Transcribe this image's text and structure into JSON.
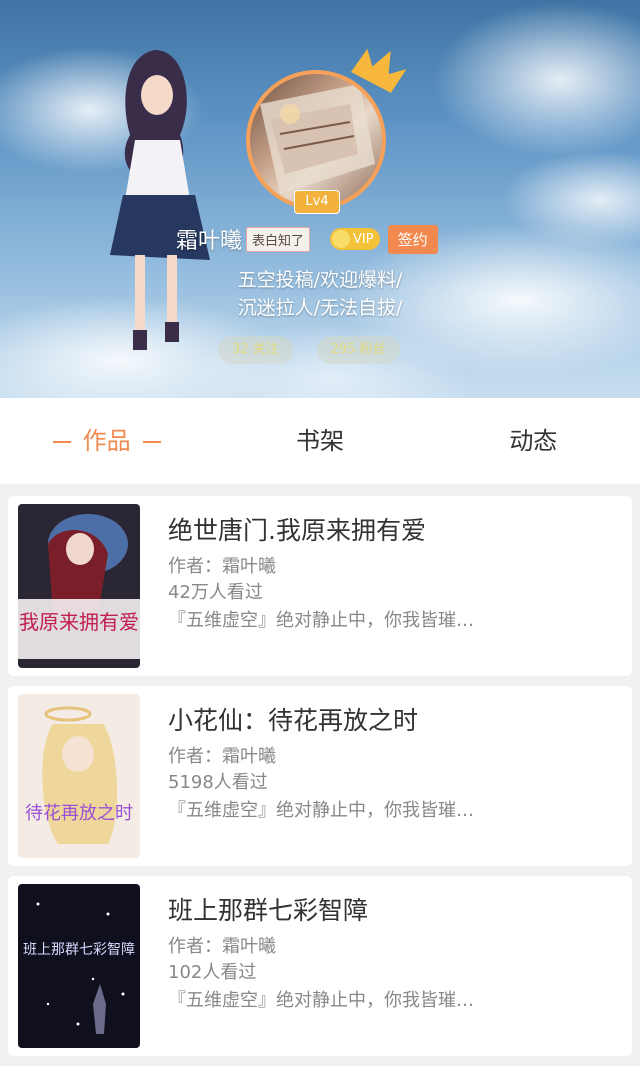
{
  "profile": {
    "level": "Lv4",
    "name": "霜叶曦",
    "title_tag": "表白知了",
    "vip_label": "VIP",
    "sign_label": "签约",
    "bio_line1": "五空投稿/欢迎爆料/",
    "bio_line2": "沉迷拉人/无法自拔/",
    "following": "32 关注",
    "fans": "295 粉丝",
    "accent_color": "#f28a4f"
  },
  "tabs": [
    {
      "label": "作品",
      "active": true
    },
    {
      "label": "书架",
      "active": false
    },
    {
      "label": "动态",
      "active": false
    }
  ],
  "books": [
    {
      "title": "绝世唐门.我原来拥有爱",
      "author": "作者：霜叶曦",
      "views": "42万人看过",
      "desc": "『五维虚空』绝对静止中，你我皆璀…",
      "cover_text": "我原来拥有爱"
    },
    {
      "title": "小花仙：待花再放之时",
      "author": "作者：霜叶曦",
      "views": "5198人看过",
      "desc": "『五维虚空』绝对静止中，你我皆璀…",
      "cover_text": "待花再放之时"
    },
    {
      "title": "班上那群七彩智障",
      "author": "作者：霜叶曦",
      "views": "102人看过",
      "desc": "『五维虚空』绝对静止中，你我皆璀…",
      "cover_text": "班上那群七彩智障"
    }
  ]
}
